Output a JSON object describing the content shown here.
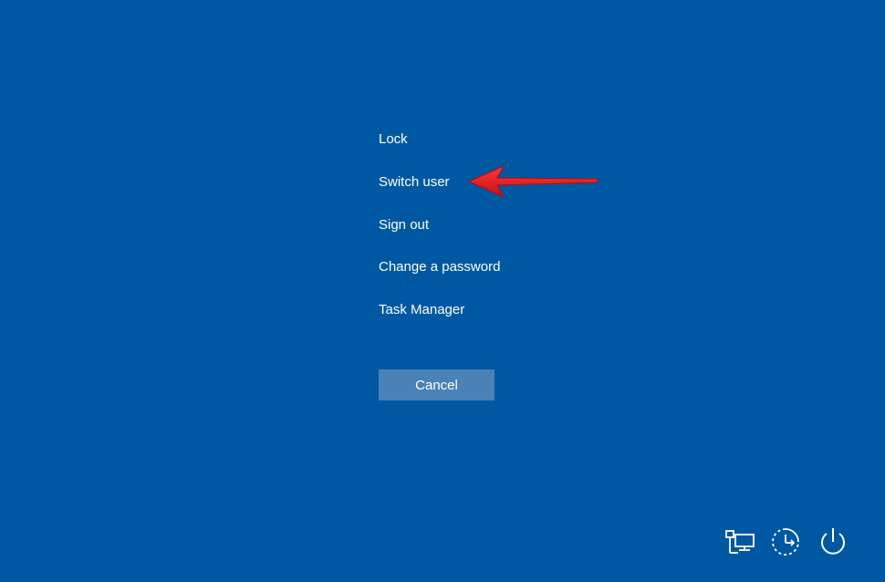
{
  "menu": {
    "items": [
      {
        "label": "Lock"
      },
      {
        "label": "Switch user"
      },
      {
        "label": "Sign out"
      },
      {
        "label": "Change a password"
      },
      {
        "label": "Task Manager"
      }
    ]
  },
  "cancel": {
    "label": "Cancel"
  },
  "annotation": {
    "arrow_color": "#e8191b",
    "arrow_icon": "red-arrow-left"
  },
  "tray": {
    "icons": [
      "network-icon",
      "ease-of-access-icon",
      "power-icon"
    ]
  },
  "colors": {
    "background": "#0058a2",
    "button": "#4a81b6",
    "text": "#ffffff"
  }
}
